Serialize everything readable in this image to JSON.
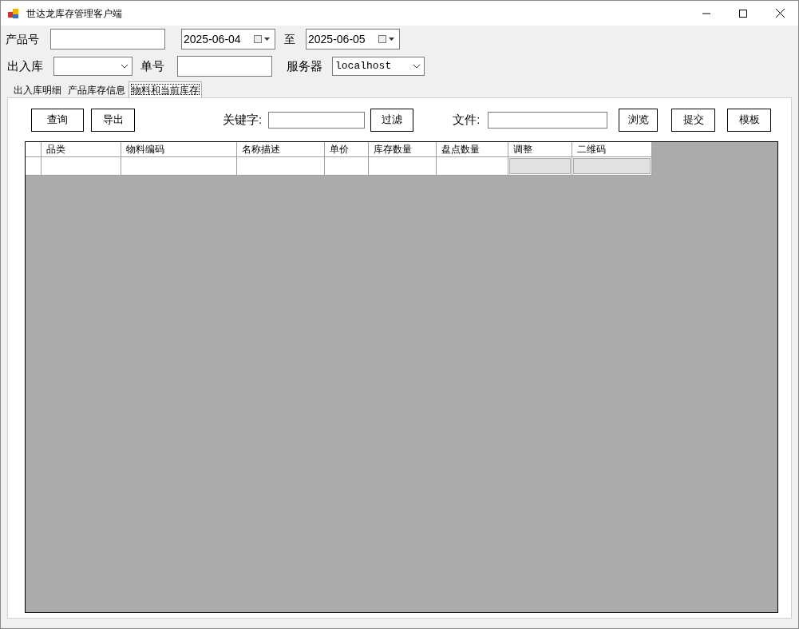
{
  "window": {
    "title": "世达龙库存管理客户端"
  },
  "filters": {
    "product_no_label": "产品号",
    "date_from": "2025-06-04",
    "to_label": "至",
    "date_to": "2025-06-05",
    "in_out_label": "出入库",
    "order_no_label": "单号",
    "server_label": "服务器",
    "server_value": "localhost"
  },
  "tabs": [
    {
      "label": "出入库明细",
      "selected": false
    },
    {
      "label": "产品库存信息",
      "selected": false
    },
    {
      "label": "物料和当前库存",
      "selected": true
    }
  ],
  "toolbar": {
    "query_button": "查询",
    "export_button": "导出",
    "keyword_label": "关键字:",
    "filter_button": "过滤",
    "file_label": "文件:",
    "browse_button": "浏览",
    "submit_button": "提交",
    "template_button": "模板"
  },
  "table": {
    "columns": [
      {
        "label": "品类",
        "kind": "text"
      },
      {
        "label": "物料编码",
        "kind": "text"
      },
      {
        "label": "名称描述",
        "kind": "text"
      },
      {
        "label": "单价",
        "kind": "text"
      },
      {
        "label": "库存数量",
        "kind": "text"
      },
      {
        "label": "盘点数量",
        "kind": "text"
      },
      {
        "label": "调整",
        "kind": "button"
      },
      {
        "label": "二维码",
        "kind": "button"
      }
    ]
  }
}
